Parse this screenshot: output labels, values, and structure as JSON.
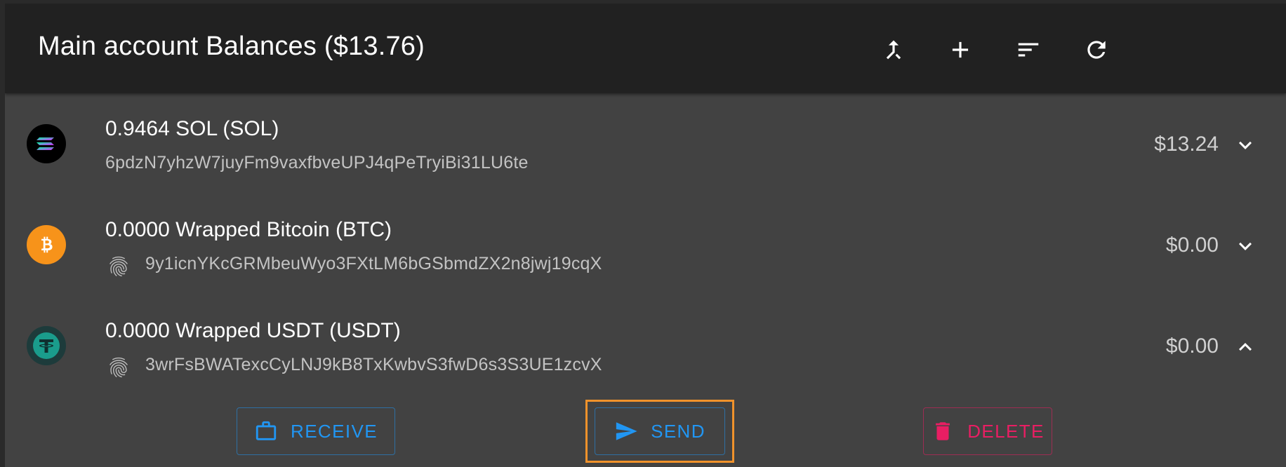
{
  "header": {
    "title": "Main account Balances ($13.76)"
  },
  "toolbar": {
    "merge_icon": "merge-icon",
    "add_icon": "plus-icon",
    "sort_icon": "sort-icon",
    "refresh_icon": "refresh-icon"
  },
  "tokens": [
    {
      "name": "0.9464 SOL (SOL)",
      "address": "6pdzN7yhzW7juyFm9vaxfbveUPJ4qPeTryiBi31LU6te",
      "value": "$13.24",
      "expanded": false,
      "icon": "solana-icon",
      "icon_color": "#000000"
    },
    {
      "name": "0.0000 Wrapped Bitcoin (BTC)",
      "address": "9y1icnYKcGRMbeuWyo3FXtLM6bGSbmdZX2n8jwj19cqX",
      "value": "$0.00",
      "expanded": false,
      "icon": "bitcoin-icon",
      "icon_color": "#f7931a"
    },
    {
      "name": "0.0000 Wrapped USDT (USDT)",
      "address": "3wrFsBWATexcCyLNJ9kB8TxKwbvS3fwD6s3S3UE1zcvX",
      "value": "$0.00",
      "expanded": true,
      "icon": "tether-icon",
      "icon_color": "#1a9c8c"
    }
  ],
  "actions": {
    "receive_label": "RECEIVE",
    "send_label": "SEND",
    "delete_label": "DELETE"
  },
  "colors": {
    "header_bg": "#212121",
    "card_bg": "#424242",
    "primary": "#2196f3",
    "danger": "#e91e63",
    "focus": "#f0922b"
  }
}
